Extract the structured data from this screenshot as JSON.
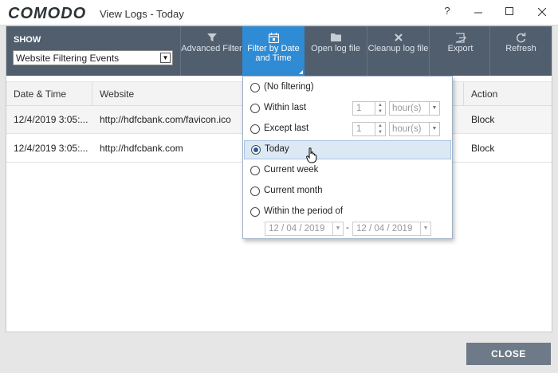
{
  "window": {
    "logo": "COMODO",
    "title": "View Logs - Today",
    "help": "?"
  },
  "toolbar": {
    "show_label": "SHOW",
    "show_value": "Website Filtering Events",
    "buttons": [
      {
        "label": "Advanced Filter",
        "icon": "funnel-icon"
      },
      {
        "label": "Filter by Date and Time",
        "icon": "calendar-icon"
      },
      {
        "label": "Open log file",
        "icon": "folder-icon"
      },
      {
        "label": "Cleanup log file",
        "icon": "cross-icon"
      },
      {
        "label": "Export",
        "icon": "export-icon"
      },
      {
        "label": "Refresh",
        "icon": "refresh-icon"
      }
    ]
  },
  "table": {
    "columns": [
      "Date & Time",
      "Website",
      "Action"
    ],
    "rows": [
      {
        "datetime": "12/4/2019 3:05:...",
        "website": "http://hdfcbank.com/favicon.ico",
        "action": "Block"
      },
      {
        "datetime": "12/4/2019 3:05:...",
        "website": "http://hdfcbank.com",
        "action": "Block"
      }
    ]
  },
  "date_filter": {
    "options": [
      "(No filtering)",
      "Within last",
      "Except last",
      "Today",
      "Current week",
      "Current month",
      "Within the period of"
    ],
    "selected": "Today",
    "within_last": {
      "count": "1",
      "unit": "hour(s)"
    },
    "except_last": {
      "count": "1",
      "unit": "hour(s)"
    },
    "period": {
      "from": "12 / 04 / 2019",
      "separator": "-",
      "to": "12 / 04 / 2019"
    }
  },
  "footer": {
    "close_label": "CLOSE"
  },
  "colors": {
    "toolbar_bg": "#505e6e",
    "active_tool": "#2f8bd4",
    "close_button": "#6e7a87",
    "selected_option": "#dde8f5"
  }
}
